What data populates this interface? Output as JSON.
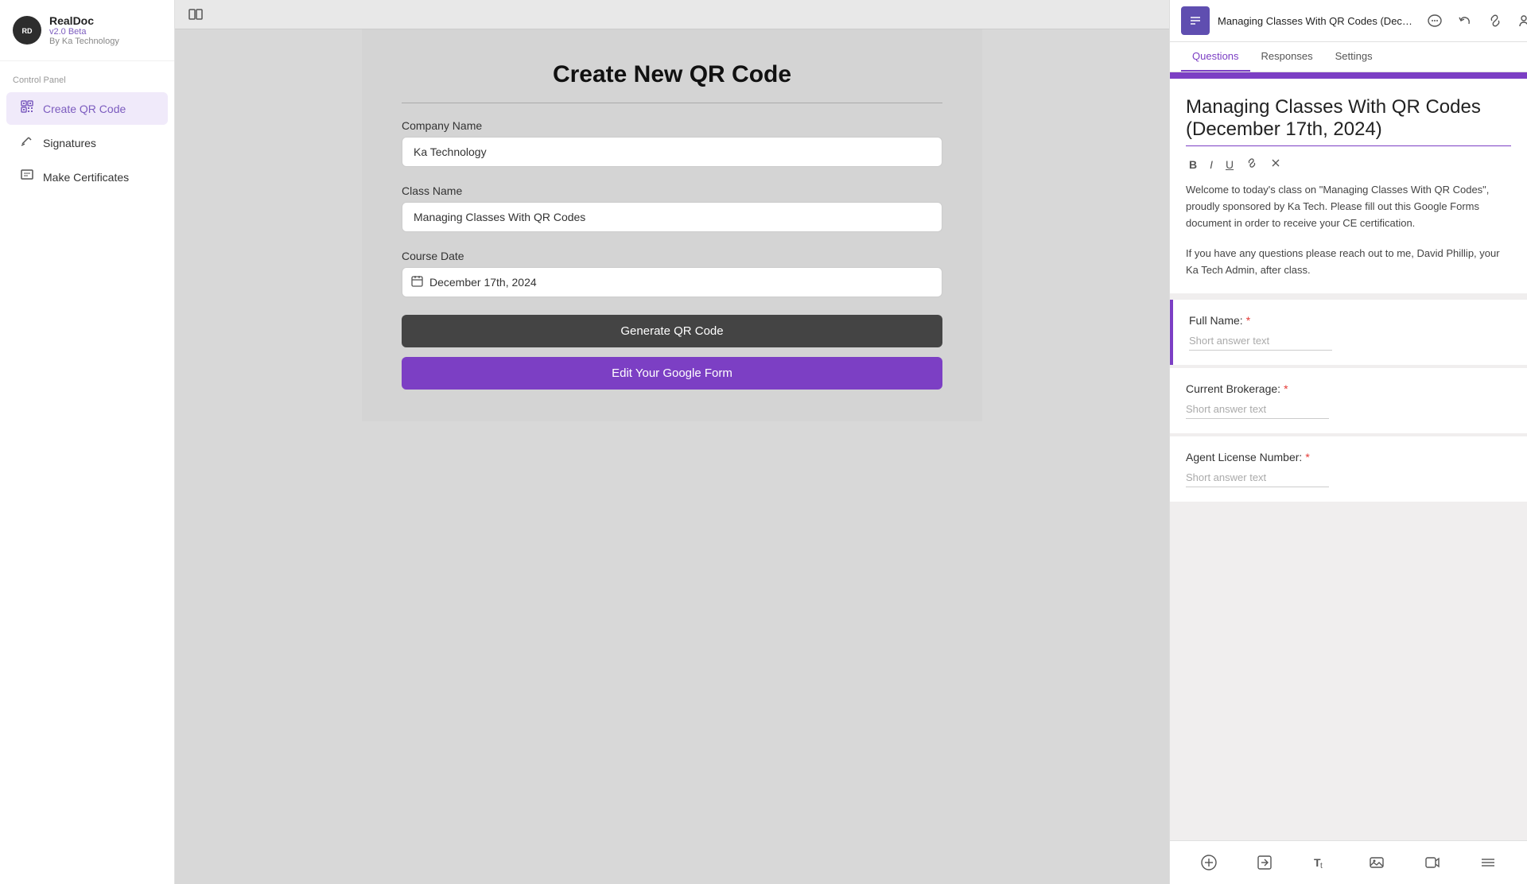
{
  "app": {
    "name": "RealDoc",
    "version": "v2.0 Beta",
    "by": "By Ka Technology",
    "logo_initials": "RD"
  },
  "sidebar": {
    "section_label": "Control Panel",
    "items": [
      {
        "id": "create-qr-code",
        "label": "Create QR Code",
        "icon": "⊞",
        "active": true
      },
      {
        "id": "signatures",
        "label": "Signatures",
        "icon": "✏️",
        "active": false
      },
      {
        "id": "make-certificates",
        "label": "Make Certificates",
        "icon": "📄",
        "active": false
      }
    ]
  },
  "main_form": {
    "title": "Create New QR Code",
    "fields": {
      "company_name": {
        "label": "Company Name",
        "value": "Ka Technology",
        "placeholder": "Company Name"
      },
      "class_name": {
        "label": "Class Name",
        "value": "Managing Classes With QR Codes",
        "placeholder": "Class Name"
      },
      "course_date": {
        "label": "Course Date",
        "value": "December 17th, 2024",
        "placeholder": "Course Date"
      }
    },
    "buttons": {
      "generate": "Generate QR Code",
      "edit_form": "Edit Your Google Form"
    }
  },
  "google_form": {
    "doc_title": "Managing Classes With QR Codes (December 17th, 20...",
    "tabs": [
      "Questions",
      "Responses",
      "Settings"
    ],
    "active_tab": "Questions",
    "form_title": "Managing Classes With QR Codes (December 17th, 2024)",
    "description_p1": "Welcome to today's class on \"Managing Classes With QR Codes\", proudly sponsored by Ka Tech. Please fill out this Google Forms document in order to receive your CE certification.",
    "description_p2": "If you have any questions please reach out to me, David Phillip, your Ka Tech Admin, after class.",
    "questions": [
      {
        "label": "Full Name:",
        "required": true,
        "answer_hint": "Short answer text",
        "active": true
      },
      {
        "label": "Current Brokerage:",
        "required": true,
        "answer_hint": "Short answer text",
        "active": false
      },
      {
        "label": "Agent License Number:",
        "required": true,
        "answer_hint": "Short answer text",
        "active": false
      }
    ],
    "toolbar_icons": {
      "add": "+",
      "import": "⬆",
      "text": "T",
      "image": "🖼",
      "video": "▶",
      "section": "="
    },
    "header_actions": {
      "comment": "💬",
      "undo": "↩",
      "link": "🔗",
      "add_person": "👤+",
      "more": "⋮"
    }
  }
}
